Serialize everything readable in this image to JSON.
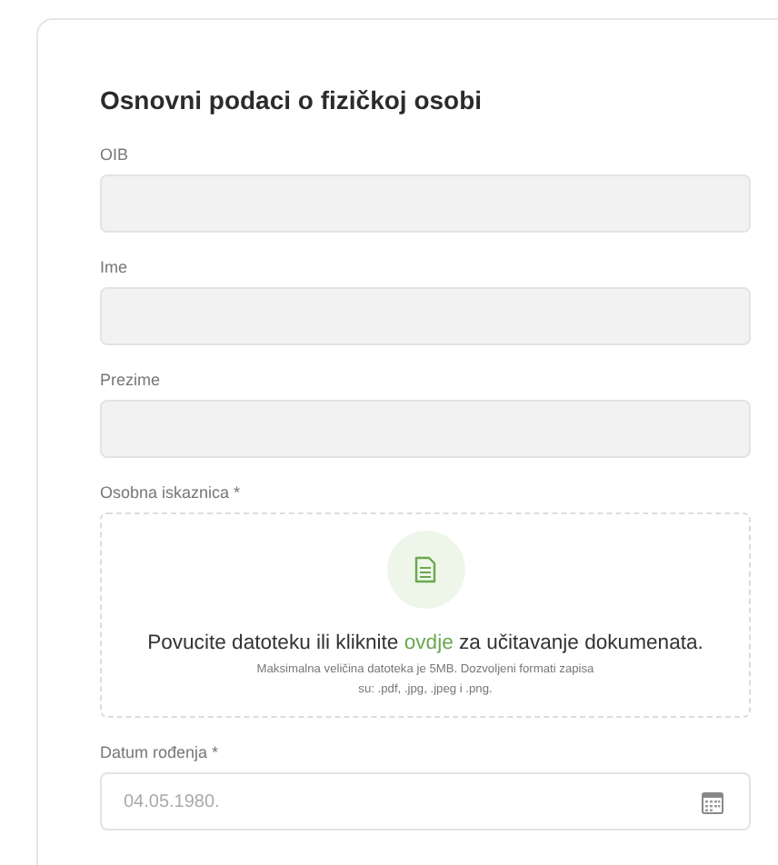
{
  "title": "Osnovni podaci o fizičkoj osobi",
  "fields": [
    {
      "kind": "text",
      "label": "OIB",
      "disabled": true
    },
    {
      "kind": "text",
      "label": "Ime",
      "disabled": true
    },
    {
      "kind": "text",
      "label": "Prezime",
      "disabled": true
    },
    {
      "kind": "upload",
      "label": "Osobna iskaznica *",
      "text_before": "Povucite datoteku ili kliknite ",
      "link": "ovdje",
      "text_after": " za učitavanje dokumenata.",
      "note": "Maksimalna veličina datoteka je 5MB. Dozvoljeni formati zapisa su: .pdf, .jpg, .jpeg i .png."
    },
    {
      "kind": "date",
      "label": "Datum rođenja *",
      "disabled": false,
      "value": "04.05.1980."
    }
  ]
}
